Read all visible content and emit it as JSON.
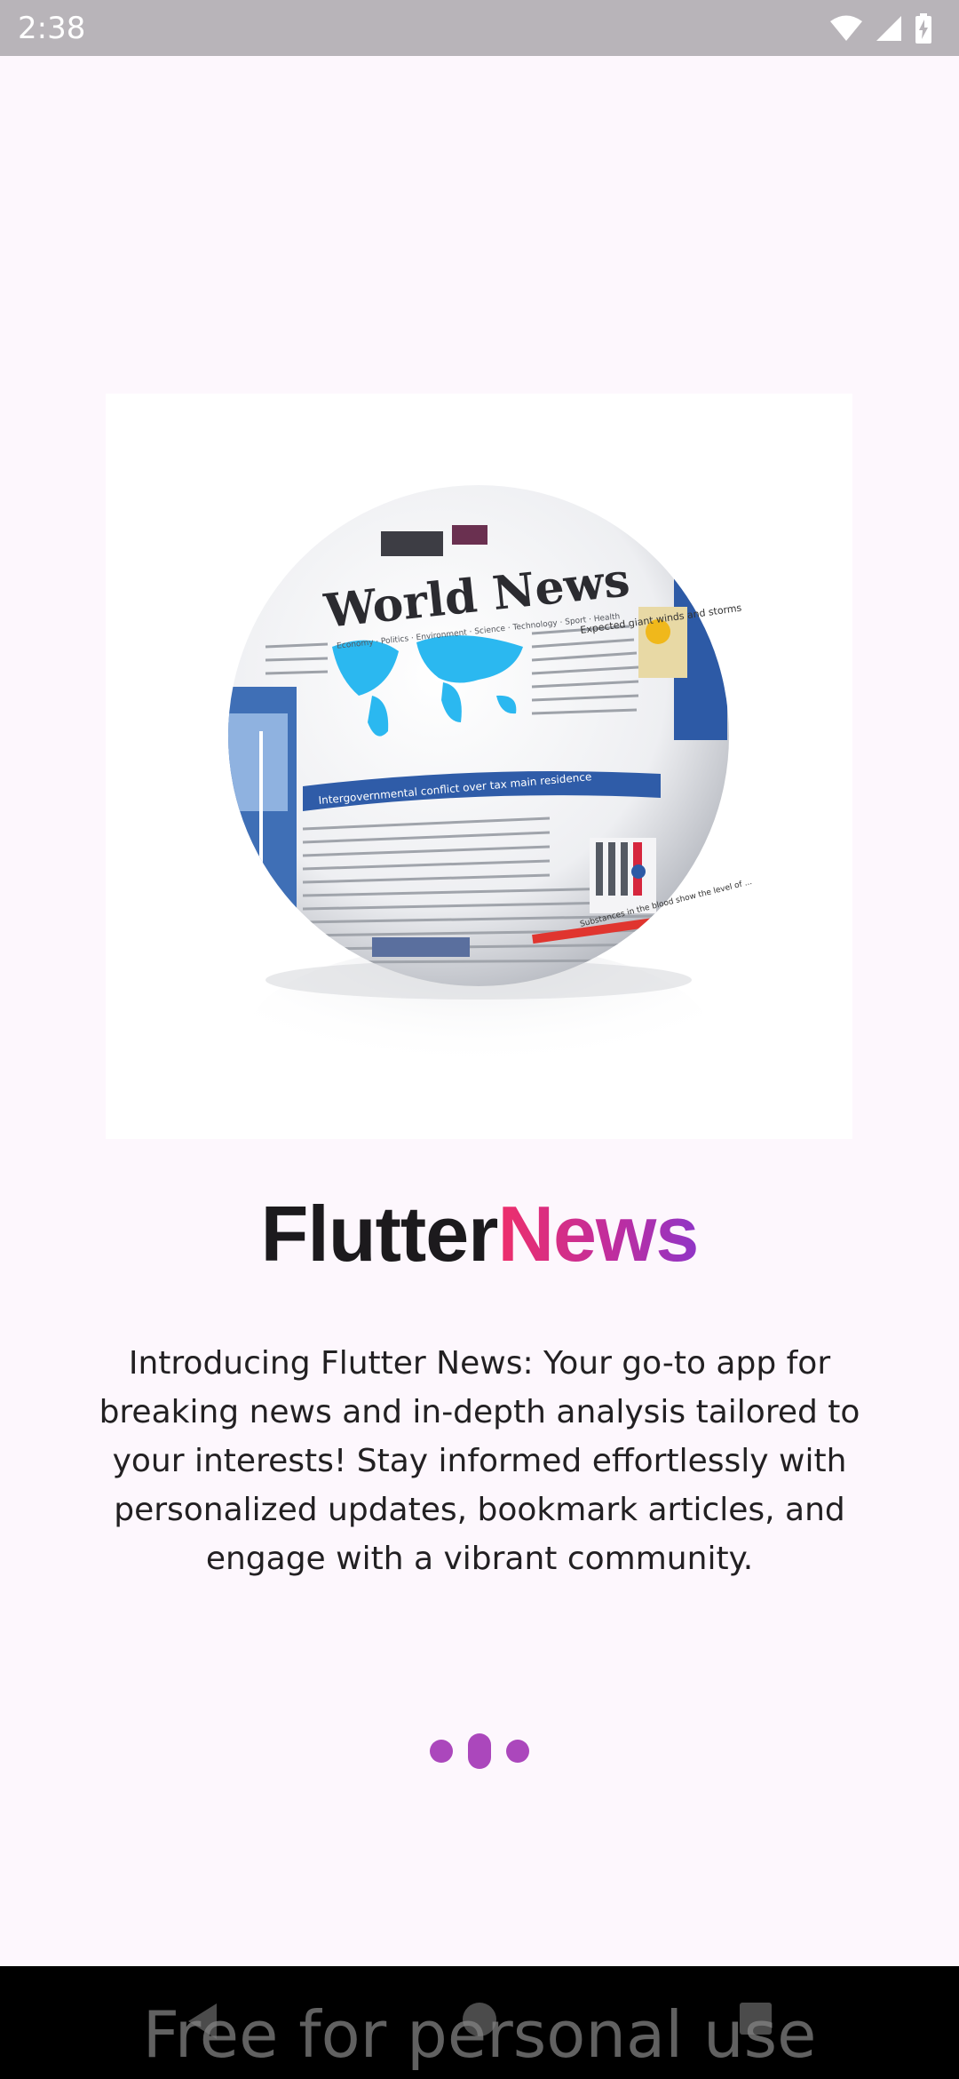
{
  "status_bar": {
    "time": "2:38",
    "icons": [
      "wifi-icon",
      "cellular-signal-icon",
      "battery-icon"
    ]
  },
  "hero": {
    "masthead": "World News",
    "masthead_subtitle": "Economy · Politics · Environment · Science · Technology · Sport · Health",
    "headline": "Intergovernmental conflict over tax main residence",
    "side_headline": "Expected giant winds and storms",
    "lower_headline": "Substances in the blood show the level of ..."
  },
  "title": {
    "part1": "Flutter",
    "part2": "News",
    "gradient_colors": [
      "#ee2f6a",
      "#c22d9c",
      "#8f35c6"
    ]
  },
  "intro": {
    "text": "Introducing Flutter News: Your go-to app for breaking news and in-depth analysis tailored to your interests! Stay informed effortlessly with personalized updates, bookmark articles, and engage with a vibrant community."
  },
  "pager": {
    "page_count": 3,
    "active_index": 1,
    "color": "#ab47bc"
  },
  "nav_bar": {
    "buttons": [
      "back-icon",
      "home-icon",
      "recents-icon"
    ],
    "watermark": "Free for personal use"
  }
}
